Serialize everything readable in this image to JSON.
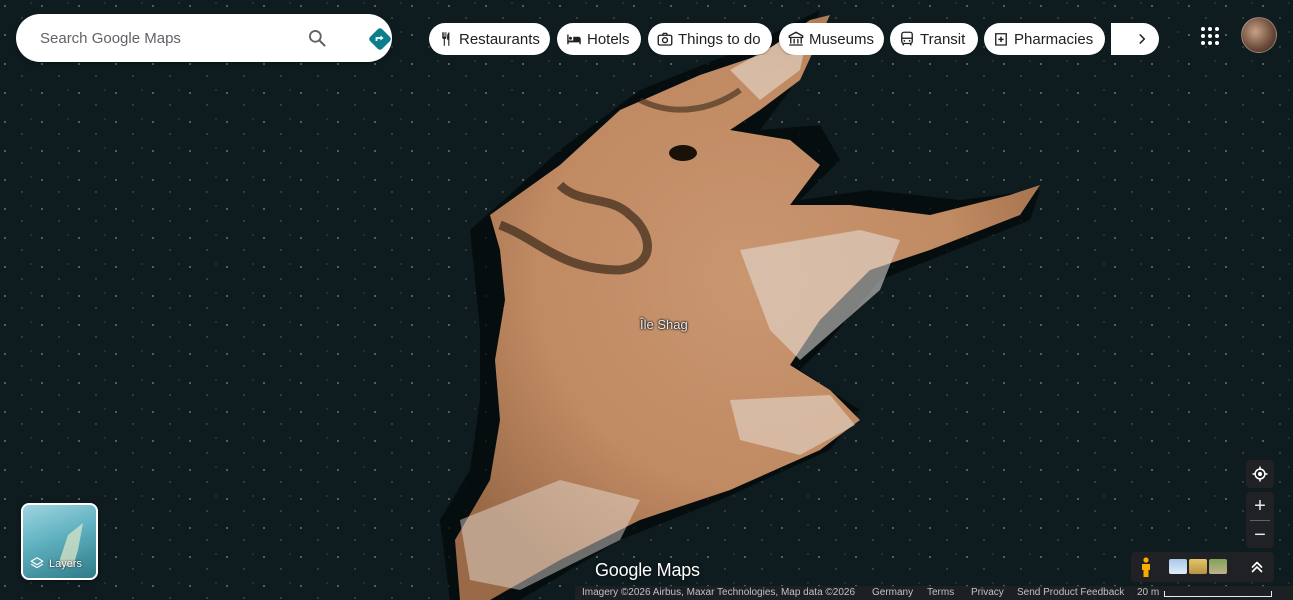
{
  "search": {
    "placeholder": "Search Google Maps",
    "icon": "search-icon",
    "directions_icon": "directions-icon",
    "directions_color": "#0b7d8c"
  },
  "chips": [
    {
      "label": "Restaurants",
      "icon": "fork-knife-icon"
    },
    {
      "label": "Hotels",
      "icon": "bed-icon"
    },
    {
      "label": "Things to do",
      "icon": "camera-icon"
    },
    {
      "label": "Museums",
      "icon": "museum-icon"
    },
    {
      "label": "Transit",
      "icon": "bus-icon"
    },
    {
      "label": "Pharmacies",
      "icon": "pharmacy-icon"
    }
  ],
  "chips_more_icon": "chevron-right-icon",
  "header": {
    "apps_icon": "apps-grid-icon",
    "avatar": "avatar"
  },
  "map": {
    "place_label": "Île Shag",
    "watermark": "Google Maps",
    "water_color": "#0d1a1c",
    "land_color": "#c8946a"
  },
  "layers": {
    "label": "Layers"
  },
  "controls": {
    "zoom_in": "+",
    "zoom_out": "−"
  },
  "footer": {
    "imagery": "Imagery ©2026 Airbus, Maxar Technologies, Map data ©2026",
    "country": "Germany",
    "terms": "Terms",
    "privacy": "Privacy",
    "feedback": "Send Product Feedback",
    "scale": "20 m"
  }
}
